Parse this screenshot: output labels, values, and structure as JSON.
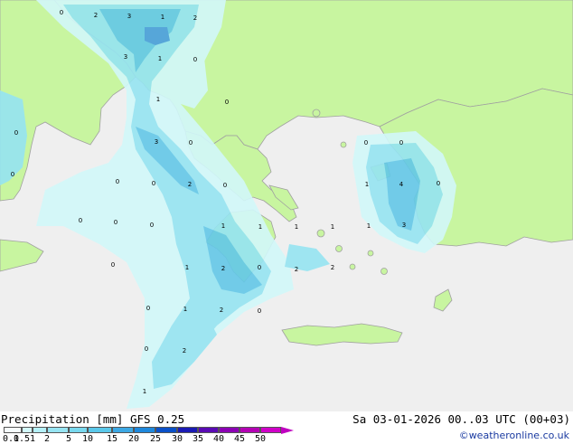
{
  "title": "Precipitation [mm]  GFS 0.25",
  "datetime": "Sa 03-01-2026 00..03 UTC (00+03)",
  "credit": "©weatheronline.co.uk",
  "colors": {
    "land": "#c8f5a0",
    "sea": "#efefef",
    "coast": "#a0a0a0",
    "precip_light": "#d2f8fa",
    "precip_mid": "#96e4f2",
    "precip_mid2": "#64c8e8",
    "precip_heavy": "#4a9ee0"
  },
  "legend": {
    "ticks": [
      "0.1",
      "0.5",
      "1",
      "2",
      "5",
      "10",
      "15",
      "20",
      "25",
      "30",
      "35",
      "40",
      "45",
      "50"
    ],
    "colors": [
      "#f5fcfd",
      "#d2f8fa",
      "#b4f0f8",
      "#96e4f2",
      "#78d8ee",
      "#5ac8ea",
      "#3ca8e4",
      "#1e88dc",
      "#0a50c8",
      "#1a1ab4",
      "#5a0ab4",
      "#8c00b4",
      "#b400b4",
      "#d000c8"
    ]
  },
  "map_labels": [
    "0",
    "2",
    "3",
    "1",
    "2",
    "3",
    "1",
    "0",
    "1",
    "0",
    "0",
    "3",
    "0",
    "0",
    "0",
    "0",
    "2",
    "0",
    "0",
    "0",
    "0",
    "1",
    "0",
    "0",
    "1",
    "1",
    "1",
    "1",
    "4",
    "1",
    "3",
    "0",
    "0",
    "1",
    "2",
    "2",
    "2",
    "0",
    "0",
    "1",
    "2",
    "0",
    "0",
    "2",
    "1"
  ]
}
